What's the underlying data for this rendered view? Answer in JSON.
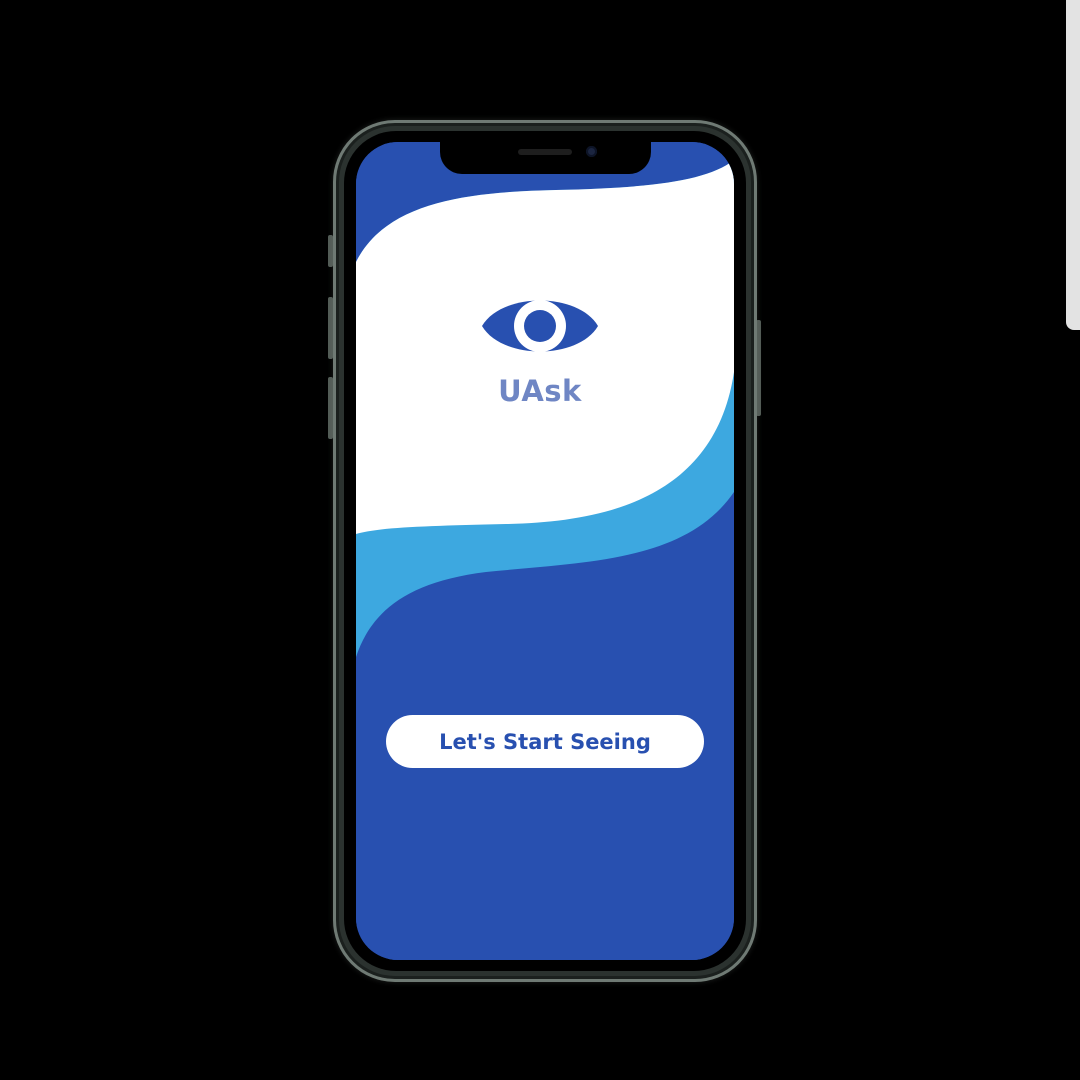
{
  "app": {
    "name": "UAsk"
  },
  "welcome": {
    "start_button_label": "Let's Start Seeing"
  },
  "icons": {
    "logo": "eye-icon"
  },
  "colors": {
    "primary_blue": "#2850b0",
    "light_blue_wave": "#3da8e0",
    "title_text": "#6f86c4",
    "background": "#000000",
    "phone_frame": "#2b322f"
  }
}
